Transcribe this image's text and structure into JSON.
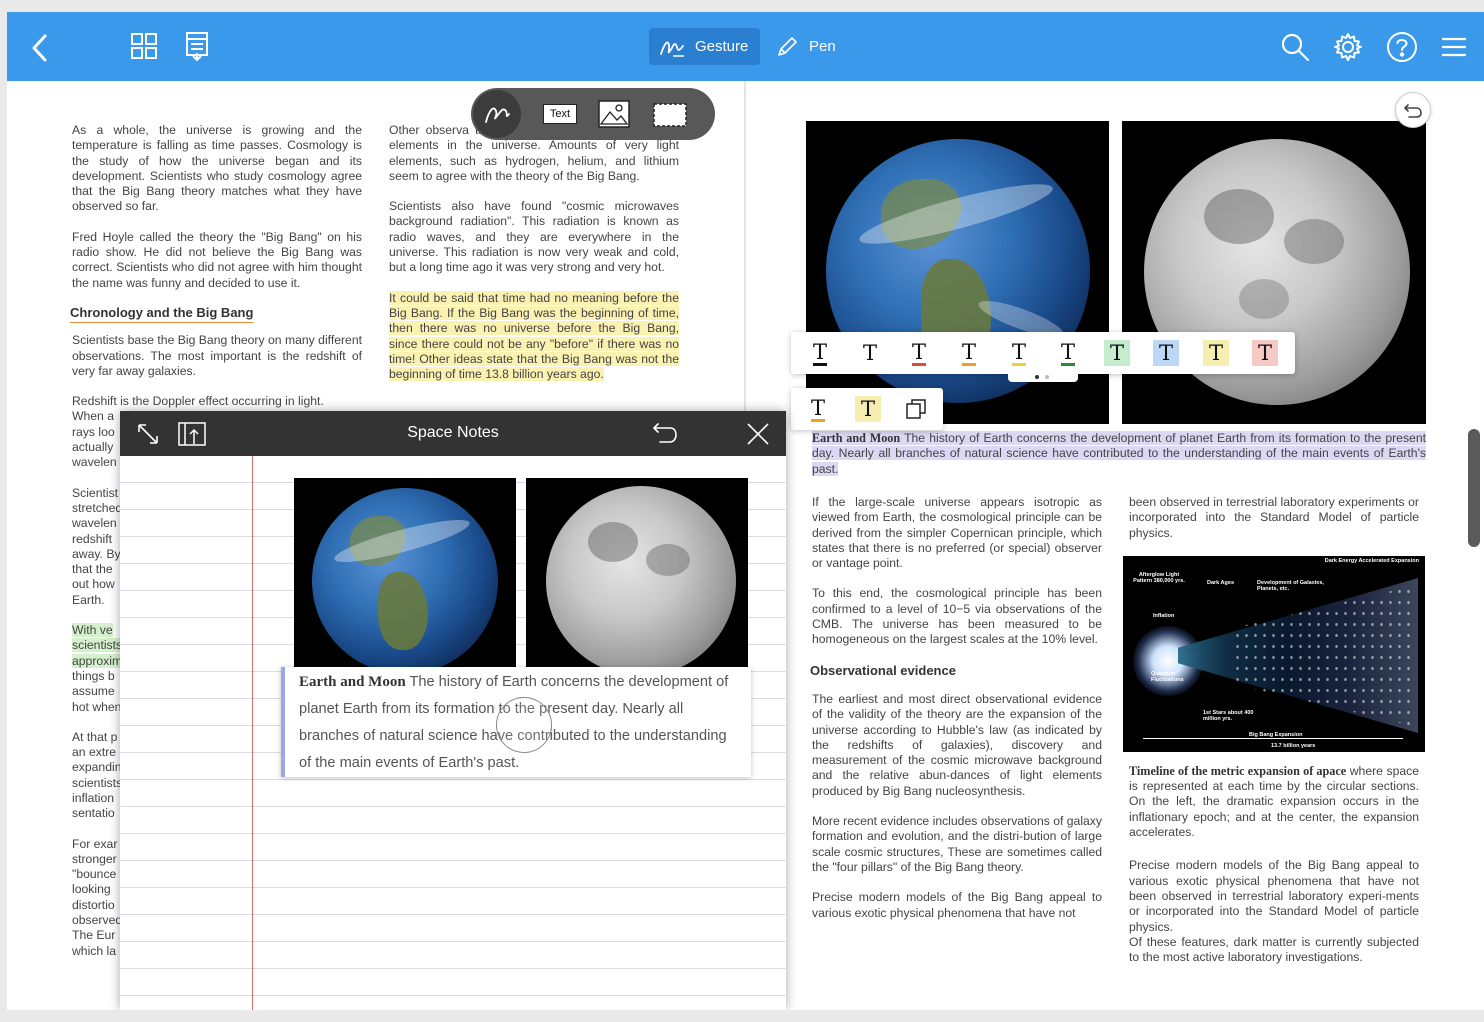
{
  "toolbar": {
    "modes": [
      {
        "label": "Gesture",
        "active": true
      },
      {
        "label": "Pen",
        "active": false
      }
    ],
    "accent": "#3a99ea"
  },
  "floating_tools": {
    "text_tool_label": "Text"
  },
  "left_page": {
    "col1": {
      "p1": "As a whole, the universe is growing and the temperature is falling as time passes. Cosmology is the study of how the universe began and its development. Scientists who study cosmology agree that the Big Bang theory matches what they have observed so far.",
      "p2": "Fred Hoyle called the theory the \"Big Bang\" on his radio show. He did not believe the Big Bang was correct. Scientists who did not agree with him thought the name was funny and decided to use it.",
      "heading": "Chronology and the Big Bang",
      "p3": "Scientists base the Big Bang theory on many different observations. The most important is the redshift of very far away galaxies.",
      "p4_lines": [
        "Redshift is the Doppler effect occurring in light.",
        "When a",
        "rays loo",
        "actually",
        "wavelen"
      ],
      "p5_lines": [
        "Scientist",
        "stretched",
        "wavelen",
        "redshift",
        "away. By",
        "that the",
        "out how",
        "Earth."
      ],
      "p6_lines": [
        "With ve",
        "scientists",
        "approxim",
        "things b",
        "assume",
        "hot when"
      ],
      "p7_lines": [
        "At that p",
        "an extre",
        "expandin",
        "scientists",
        "inflation",
        "sentatio"
      ],
      "p8_lines": [
        "For exar",
        "stronger",
        "\"bounce",
        "looking",
        "distortio",
        "observed",
        "The Eur",
        "which la"
      ]
    },
    "col2": {
      "p1": "Other observa theory are the amounts of chemical elements in the universe. Amounts of very light elements, such as hydrogen, helium, and lithium seem to agree with the theory of the Big Bang.",
      "p2": "Scientists also have found \"cosmic microwaves background radiation\". This radiation is known as radio waves, and they are everywhere in the universe. This radiation is now very weak and cold, but a long time ago it was very strong and very hot.",
      "p3": "It could be said that time had no meaning before the Big Bang. If the Big Bang was the beginning of time, then there was no universe before the Big Bang, since there could not be any \"before\" if there was no time! Other ideas state that the Big Bang was not the beginning of time 13.8 billion years ago."
    }
  },
  "space_notes": {
    "title": "Space Notes",
    "snippet_bold": "Earth and Moon",
    "snippet_text": " The history of Earth concerns the development of planet Earth from its formation to the present day. Nearly all branches of natural science have contributed to the understanding of the main events of Earth's past."
  },
  "right_page": {
    "caption_bold": "Earth and Moon",
    "caption_text": " The history of Earth concerns the development of planet Earth from its formation to the present day. Nearly all branches of natural science have contributed to the understanding of the main events of Earth's past.",
    "col1": {
      "p1": "If the large-scale universe appears isotropic as viewed from Earth, the cosmological principle can be derived from the simpler Copernican principle, which states that there is no preferred (or special) observer or vantage point.",
      "p2": "To this end, the cosmological principle has been confirmed to a level of 10−5 via observations of the CMB. The universe has been measured to be homogeneous on the largest scales at the 10% level.",
      "heading": "Observational evidence",
      "p3": "The earliest and most direct observational evidence of the validity of the theory are the expansion of the universe according to Hubble's law (as indicated by the redshifts of galaxies), discovery and measurement of the cosmic microwave background and the relative abun-dances of light elements produced by Big Bang nucleosynthesis.",
      "p4": "More recent evidence includes observations of galaxy formation and evolution, and the distri-bution of large scale cosmic structures, These are sometimes called the \"four pillars\" of the Big Bang theory.",
      "p5": "Precise modern models of the Big Bang appeal to various exotic physical phenomena that have not"
    },
    "col2": {
      "p1": "been observed in terrestrial laboratory experiments or incorporated into the Standard Model of particle physics.",
      "figure_caption_bold": "Timeline of the metric expansion of apace",
      "figure_caption_text": " where space is represented at each time by the circular sections. On the left, the dramatic expansion occurs in the inflationary epoch; and at the center, the expansion accelerates.",
      "p2": "Precise modern models of the Big Bang appeal to various exotic physical phenomena that have not been observed in terrestrial laboratory experi-ments or incorporated into the Standard Model of particle physics.",
      "p3": "Of these features, dark matter is currently subjected to the most active laboratory investigations."
    },
    "figure_labels": {
      "dark_energy": "Dark Energy Accelerated Expansion",
      "afterglow": "Afterglow Light Pattern 380,000 yrs.",
      "dark_ages": "Dark Ages",
      "development": "Development of Galaxies, Planets, etc.",
      "inflation": "Inflation",
      "quantum": "Quantum Fluctuations",
      "first_stars": "1st Stars about 400 million yrs.",
      "big_bang_expansion": "Big Bang Expansion",
      "billion_years": "13.7 billion years"
    }
  },
  "text_palette": {
    "glyph": "T",
    "styles": [
      {
        "kind": "underline",
        "color": "#111111"
      },
      {
        "kind": "plain",
        "color": ""
      },
      {
        "kind": "underline",
        "color": "#e04b3a"
      },
      {
        "kind": "underline",
        "color": "#f0a020"
      },
      {
        "kind": "underline",
        "color": "#e8d23a"
      },
      {
        "kind": "underline",
        "color": "#2a8a3a"
      },
      {
        "kind": "highlight",
        "color": "#c6ecd0"
      },
      {
        "kind": "highlight",
        "color": "#bcd8f6"
      },
      {
        "kind": "highlight",
        "color": "#f6edb0"
      },
      {
        "kind": "highlight",
        "color": "#f6c9c4"
      }
    ],
    "row2": [
      {
        "kind": "underline",
        "color": "#f0a020"
      },
      {
        "kind": "highlight",
        "color": "#f6edb0"
      }
    ]
  }
}
